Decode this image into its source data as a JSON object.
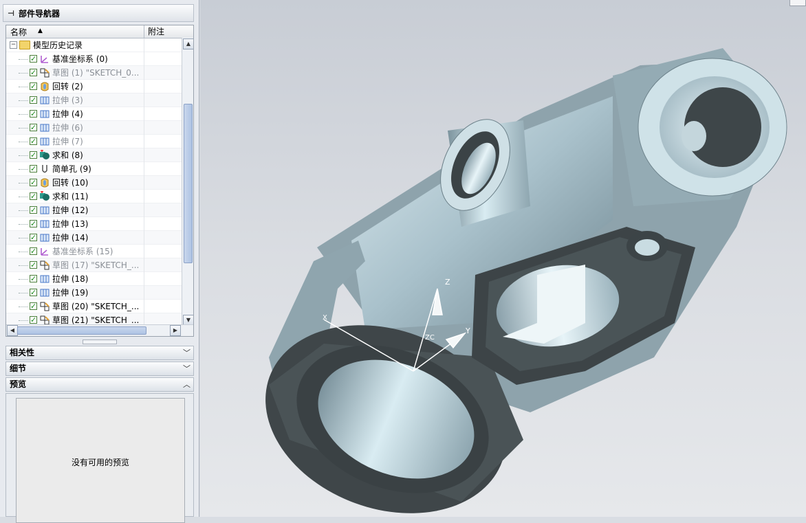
{
  "navigator": {
    "title": "部件导航器",
    "pin_icon": "pin-icon",
    "columns": {
      "name": "名称",
      "note": "附注"
    },
    "root": "模型历史记录",
    "items": [
      {
        "label": "基准坐标系 (0)",
        "icon": "datum-csys-icon",
        "dim": false
      },
      {
        "label": "草图 (1) \"SKETCH_0...",
        "icon": "sketch-icon",
        "dim": true
      },
      {
        "label": "回转 (2)",
        "icon": "revolve-icon",
        "dim": false
      },
      {
        "label": "拉伸 (3)",
        "icon": "extrude-icon",
        "dim": true
      },
      {
        "label": "拉伸 (4)",
        "icon": "extrude-icon",
        "dim": false
      },
      {
        "label": "拉伸 (6)",
        "icon": "extrude-icon",
        "dim": true
      },
      {
        "label": "拉伸 (7)",
        "icon": "extrude-icon",
        "dim": true
      },
      {
        "label": "求和 (8)",
        "icon": "unite-icon",
        "dim": false
      },
      {
        "label": "简单孔 (9)",
        "icon": "hole-icon",
        "dim": false
      },
      {
        "label": "回转 (10)",
        "icon": "revolve-icon",
        "dim": false
      },
      {
        "label": "求和 (11)",
        "icon": "unite-icon",
        "dim": false
      },
      {
        "label": "拉伸 (12)",
        "icon": "extrude-icon",
        "dim": false
      },
      {
        "label": "拉伸 (13)",
        "icon": "extrude-icon",
        "dim": false
      },
      {
        "label": "拉伸 (14)",
        "icon": "extrude-icon",
        "dim": false
      },
      {
        "label": "基准坐标系 (15)",
        "icon": "datum-csys-icon",
        "dim": true
      },
      {
        "label": "草图 (17) \"SKETCH_...",
        "icon": "sketch-icon",
        "dim": true
      },
      {
        "label": "拉伸 (18)",
        "icon": "extrude-icon",
        "dim": false
      },
      {
        "label": "拉伸 (19)",
        "icon": "extrude-icon",
        "dim": false
      },
      {
        "label": "草图 (20) \"SKETCH_...",
        "icon": "sketch-icon",
        "dim": false
      },
      {
        "label": "草图 (21) \"SKETCH_...",
        "icon": "sketch-icon",
        "dim": false
      }
    ]
  },
  "panels": {
    "dependencies": "相关性",
    "details": "细节",
    "preview": "预览",
    "preview_empty": "没有可用的预览"
  },
  "viewport": {
    "triad": {
      "z": "Z",
      "y": "Y",
      "x": "X",
      "zc": "ZC"
    },
    "model_color": "#b9cfd8",
    "shadow_color": "#3e4548"
  }
}
